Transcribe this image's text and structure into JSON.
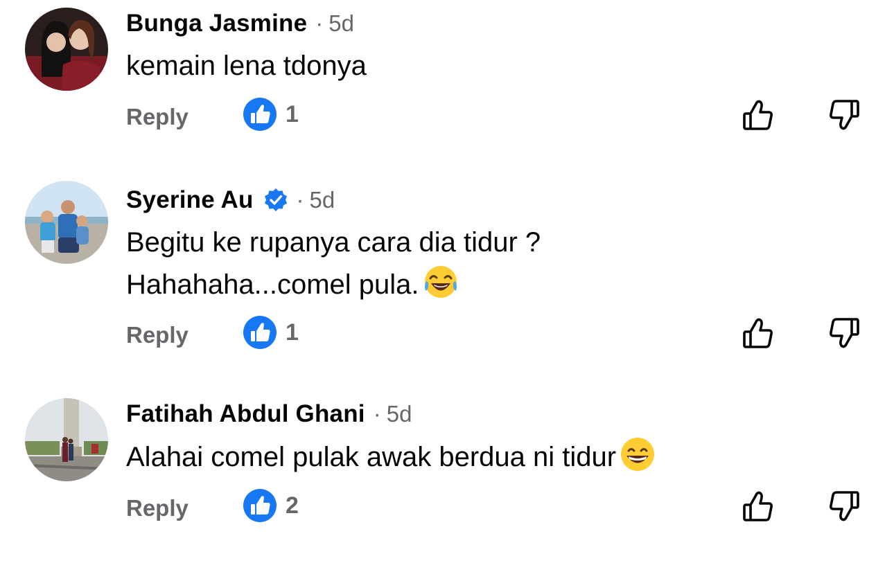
{
  "comments": [
    {
      "author": "Bunga Jasmine",
      "verified": false,
      "separator": "·",
      "time": "5d",
      "lines": "kemain lena tdonya",
      "reply_label": "Reply",
      "like_count": "1",
      "emoji": null
    },
    {
      "author": "Syerine Au",
      "verified": true,
      "separator": "·",
      "time": "5d",
      "lines": "Begitu ke rupanya cara dia tidur ?\nHahahaha...comel pula.",
      "reply_label": "Reply",
      "like_count": "1",
      "emoji": "face-with-tears-of-joy"
    },
    {
      "author": "Fatihah Abdul Ghani",
      "verified": false,
      "separator": "·",
      "time": "5d",
      "lines": "Alahai comel pulak awak berdua ni tidur",
      "reply_label": "Reply",
      "like_count": "2",
      "emoji": "grinning-face-with-smiling-eyes"
    }
  ],
  "colors": {
    "accent_blue": "#1877f2",
    "secondary_text": "#65676b",
    "primary_text": "#050505"
  }
}
